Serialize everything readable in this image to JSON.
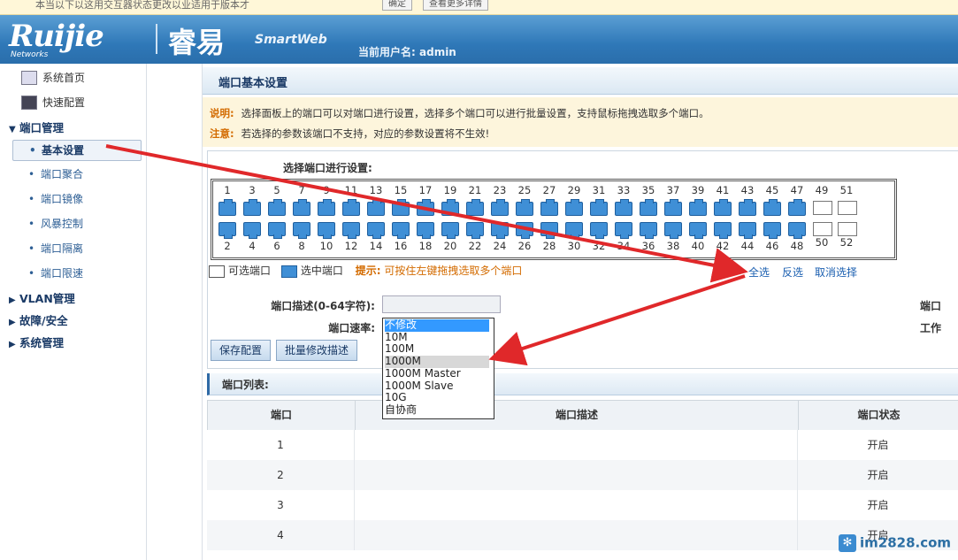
{
  "notice": {
    "text": "本当以下以这用交互器状态更改以业适用于版本才",
    "btn1": "确定",
    "btn2": "查看更多详情"
  },
  "header": {
    "logo": "Ruijie",
    "logo_sub": "Networks",
    "logo_cn": "睿易",
    "product": "SmartWeb",
    "user_label": "当前用户名:",
    "user": "admin"
  },
  "sidebar": {
    "top_items": [
      {
        "label": "系统首页",
        "icon": "monitor-icon"
      },
      {
        "label": "快速配置",
        "icon": "wizard-icon"
      }
    ],
    "groups": [
      {
        "label": "端口管理",
        "expanded": true,
        "items": [
          "基本设置",
          "端口聚合",
          "端口镜像",
          "风暴控制",
          "端口隔离",
          "端口限速"
        ]
      },
      {
        "label": "VLAN管理",
        "expanded": false
      },
      {
        "label": "故障/安全",
        "expanded": false
      },
      {
        "label": "系统管理",
        "expanded": false
      }
    ]
  },
  "main": {
    "title": "端口基本设置",
    "note_label": "说明:",
    "note_text": "选择面板上的端口可以对端口进行设置，选择多个端口可以进行批量设置，支持鼠标拖拽选取多个端口。",
    "warn_label": "注意:",
    "warn_text": "若选择的参数该端口不支持，对应的参数设置将不生效!",
    "select_title": "选择端口进行设置:",
    "legend_available": "可选端口",
    "legend_selected": "选中端口",
    "hint_label": "提示:",
    "hint_text": "可按住左键拖拽选取多个端口",
    "select_all": "全选",
    "invert": "反选",
    "deselect": "取消选择",
    "desc_label": "端口描述(0-64字符):",
    "speed_label": "端口速率:",
    "right_label1": "端口",
    "right_label2": "工作",
    "speed_options": [
      "不修改",
      "10M",
      "100M",
      "1000M",
      "1000M Master",
      "1000M Slave",
      "10G",
      "自协商"
    ],
    "speed_selected": "不修改",
    "speed_hover": "1000M",
    "save_btn": "保存配置",
    "batch_btn": "批量修改描述",
    "list_title": "端口列表:",
    "columns": [
      "端口",
      "端口描述",
      "端口状态"
    ],
    "rows": [
      {
        "port": "1",
        "desc": "",
        "status": "开启"
      },
      {
        "port": "2",
        "desc": "",
        "status": "开启"
      },
      {
        "port": "3",
        "desc": "",
        "status": "开启"
      },
      {
        "port": "4",
        "desc": "",
        "status": "开启"
      }
    ]
  },
  "ports": {
    "top": [
      "1",
      "3",
      "5",
      "7",
      "9",
      "11",
      "13",
      "15",
      "17",
      "19",
      "21",
      "23",
      "25",
      "27",
      "29",
      "31",
      "33",
      "35",
      "37",
      "39",
      "41",
      "43",
      "45",
      "47",
      "49",
      "51"
    ],
    "bottom": [
      "2",
      "4",
      "6",
      "8",
      "10",
      "12",
      "14",
      "16",
      "18",
      "20",
      "22",
      "24",
      "26",
      "28",
      "30",
      "32",
      "34",
      "36",
      "38",
      "40",
      "42",
      "44",
      "46",
      "48",
      "50",
      "52"
    ]
  },
  "watermark": "im2828.com",
  "colors": {
    "accent": "#2f78b8",
    "port_selected": "#3f8fd6",
    "warning": "#d36b00",
    "arrow": "#e0282a"
  }
}
